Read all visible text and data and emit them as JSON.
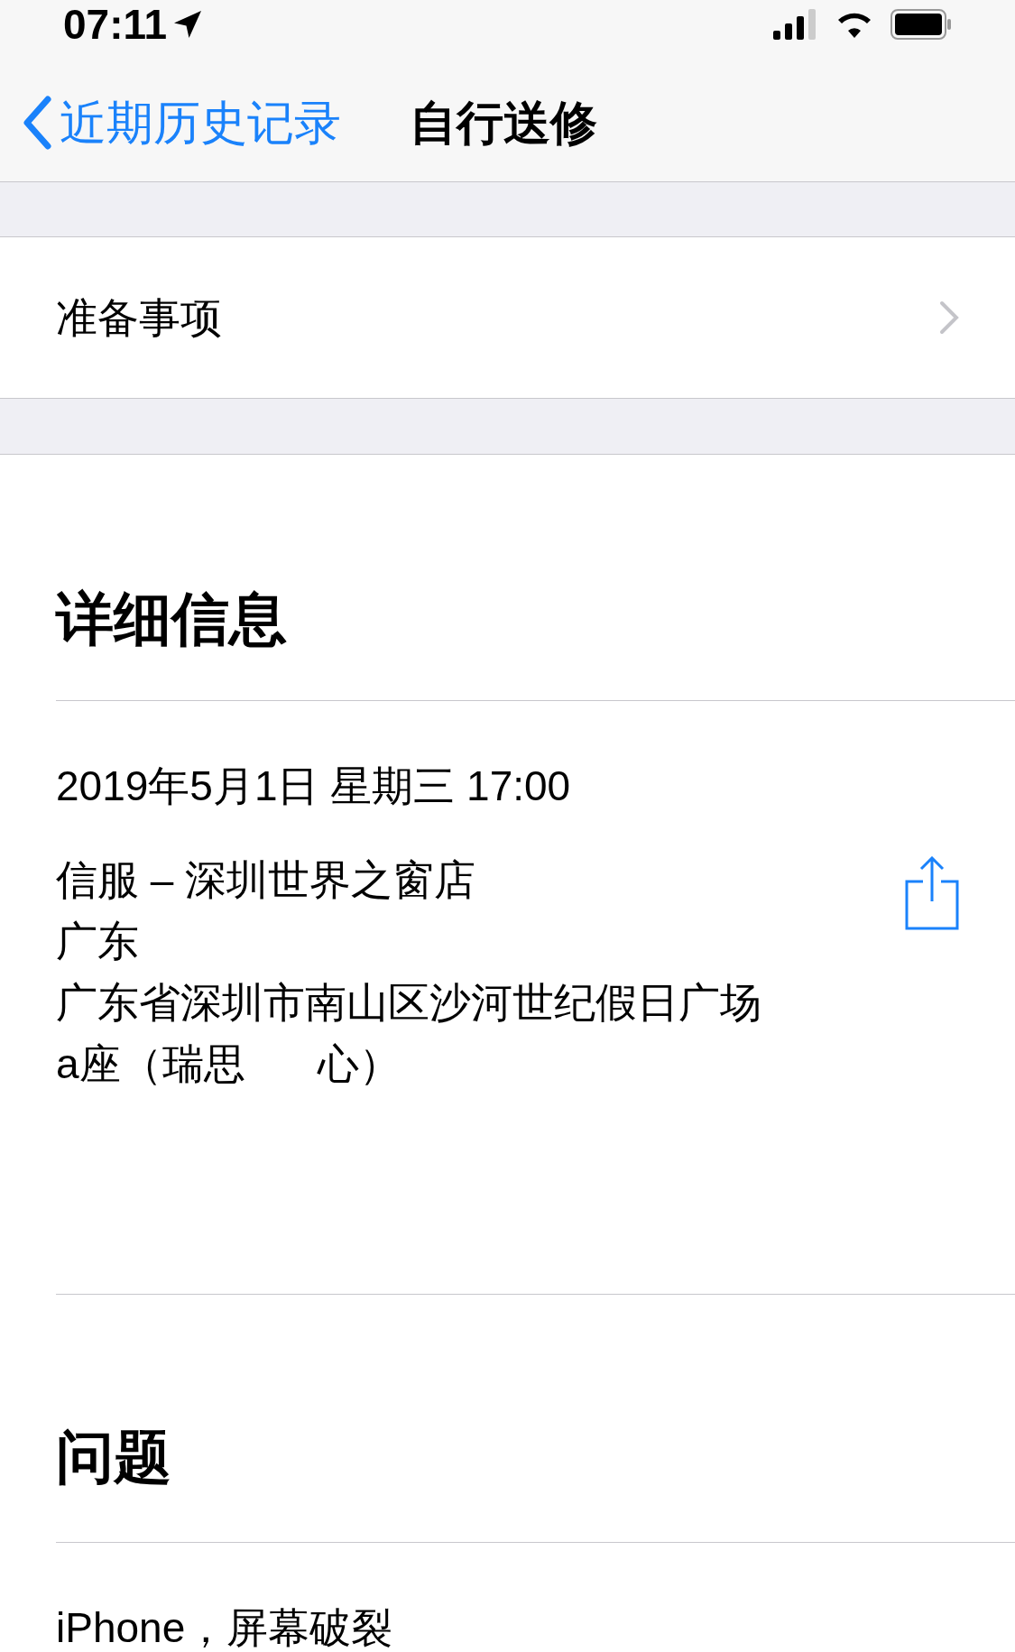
{
  "status_bar": {
    "time": "07:11"
  },
  "nav": {
    "back": "近期历史记录",
    "title": "自行送修"
  },
  "prep_row": {
    "label": "准备事项"
  },
  "details": {
    "heading": "详细信息",
    "datetime": "2019年5月1日 星期三 17:00",
    "store": "信服 – 深圳世界之窗店",
    "province": "广东",
    "address": "广东省深圳市南山区沙河世纪假日广场",
    "address_line2_parts": [
      "a座（瑞思",
      "心）"
    ]
  },
  "problem": {
    "heading": "问题",
    "text": "iPhone，屏幕破裂"
  }
}
